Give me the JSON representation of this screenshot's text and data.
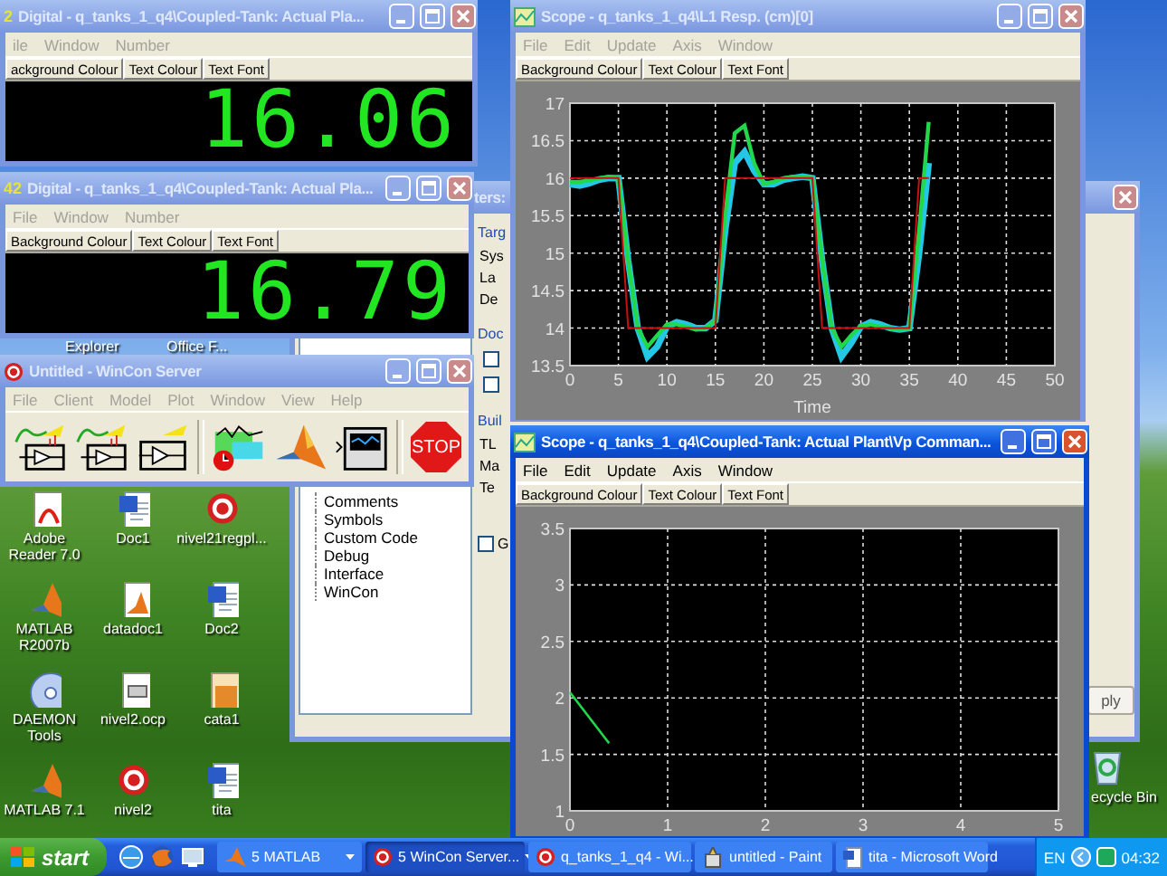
{
  "desktop_icons": [
    {
      "label": "Adobe Reader 7.0",
      "kind": "pdf"
    },
    {
      "label": "Doc1",
      "kind": "word"
    },
    {
      "label": "nivel21regpl...",
      "kind": "wincon"
    },
    {
      "label": "MATLAB R2007b",
      "kind": "matlab"
    },
    {
      "label": "datadoc1",
      "kind": "matfile"
    },
    {
      "label": "Doc2",
      "kind": "word"
    },
    {
      "label": "DAEMON Tools",
      "kind": "disc"
    },
    {
      "label": "nivel2.ocp",
      "kind": "file"
    },
    {
      "label": "cata1",
      "kind": "image"
    },
    {
      "label": "MATLAB 7.1",
      "kind": "matlab"
    },
    {
      "label": "nivel2",
      "kind": "wincon"
    },
    {
      "label": "tita",
      "kind": "word"
    }
  ],
  "partial_icon_labels": [
    "Explorer",
    "Office F..."
  ],
  "recycle_bin": {
    "label": "ecycle Bin"
  },
  "windows": [
    {
      "kind": "digital",
      "active": false,
      "icon_text": "2",
      "title": "Digital - q_tanks_1_q4\\Coupled-Tank: Actual Pla...",
      "menu": [
        "ile",
        "Window",
        "Number"
      ],
      "toolbar": [
        "ackground Colour",
        "Text Colour",
        "Text Font"
      ],
      "reading": "16.06"
    },
    {
      "kind": "scope",
      "active": false,
      "title": "Scope - q_tanks_1_q4\\L1 Resp. (cm)[0]",
      "menu": [
        "File",
        "Edit",
        "Update",
        "Axis",
        "Window"
      ],
      "toolbar": [
        "Background Colour",
        "Text Colour",
        "Text Font"
      ],
      "chart_data": {
        "type": "line",
        "grid": true,
        "xlabel": "Time",
        "x": [
          0,
          1,
          2,
          3,
          4,
          5,
          6,
          7,
          8,
          9,
          10,
          11,
          12,
          13,
          14,
          15,
          16,
          17,
          18,
          19,
          20,
          21,
          22,
          23,
          24,
          25,
          26,
          27,
          28,
          29,
          30,
          31,
          32,
          33,
          34,
          35,
          36,
          37
        ],
        "xlim": [
          0,
          50
        ],
        "ylim": [
          13.5,
          17
        ],
        "xticks": [
          0,
          5,
          10,
          15,
          20,
          25,
          30,
          35,
          40,
          45,
          50
        ],
        "yticks": [
          13.5,
          14,
          14.5,
          15,
          15.5,
          16,
          16.5,
          17
        ],
        "series": [
          {
            "color": "#c81010",
            "values": [
              16,
              16,
              16,
              16,
              16,
              16,
              14,
              14,
              14,
              14,
              14,
              14,
              14,
              14,
              14,
              14,
              16,
              16,
              16,
              16,
              16,
              16,
              16,
              16,
              16,
              16,
              14,
              14,
              14,
              14,
              14,
              14,
              14,
              14,
              14,
              14,
              16,
              16
            ]
          },
          {
            "color": "#22d84a",
            "values": [
              15.95,
              15.95,
              15.97,
              16,
              16.02,
              16,
              14.9,
              14,
              13.75,
              13.9,
              14.05,
              14.05,
              14.02,
              13.98,
              14,
              14.1,
              15.5,
              16.6,
              16.7,
              16.2,
              15.92,
              15.95,
              16,
              16.02,
              16.02,
              16,
              14.9,
              14,
              13.75,
              13.9,
              14.03,
              14.05,
              14.02,
              14,
              13.98,
              14,
              15.3,
              16.75
            ]
          },
          {
            "color": "#22c8e6",
            "values": [
              15.92,
              15.9,
              15.93,
              15.98,
              16,
              16,
              14.9,
              14,
              13.62,
              13.75,
              14.02,
              14.08,
              14.05,
              14,
              14,
              14.1,
              15.3,
              16.2,
              16.35,
              16.1,
              15.92,
              15.92,
              15.98,
              16,
              16.02,
              16,
              14.9,
              14,
              13.62,
              13.8,
              14.02,
              14.08,
              14.05,
              14,
              13.98,
              14,
              15,
              16.2
            ]
          }
        ]
      }
    },
    {
      "kind": "digital",
      "active": false,
      "icon_text": "42",
      "title": "Digital - q_tanks_1_q4\\Coupled-Tank: Actual Pla...",
      "menu": [
        "File",
        "Window",
        "Number"
      ],
      "toolbar": [
        "Background Colour",
        "Text Colour",
        "Text Font"
      ],
      "reading": "16.79"
    },
    {
      "kind": "options",
      "active": false,
      "title": "ters:",
      "sections": [
        {
          "heading": "Targ",
          "items": [
            {
              "kind": "label",
              "text": "Sys"
            },
            {
              "kind": "label",
              "text": "La"
            },
            {
              "kind": "label",
              "text": "De"
            }
          ]
        },
        {
          "heading": "Doc",
          "items": [
            {
              "kind": "checkbox",
              "checked": false
            },
            {
              "kind": "checkbox",
              "checked": false
            }
          ]
        },
        {
          "heading": "Buil",
          "items": [
            {
              "kind": "label",
              "text": "TL"
            },
            {
              "kind": "label",
              "text": "Ma"
            },
            {
              "kind": "label",
              "text": "Te"
            }
          ]
        }
      ],
      "checkbox": {
        "label": "G",
        "checked": false
      },
      "tree": [
        "Comments",
        "Symbols",
        "Custom Code",
        "Debug",
        "Interface",
        "WinCon"
      ],
      "button": "ply"
    },
    {
      "kind": "wincon",
      "active": false,
      "title": "Untitled - WinCon Server",
      "menu": [
        "File",
        "Client",
        "Model",
        "Plot",
        "Window",
        "View",
        "Help"
      ],
      "tools": [
        {
          "kind": "plot_amp"
        },
        {
          "kind": "plot_amp"
        },
        {
          "kind": "amp"
        },
        {
          "kind": "separator"
        },
        {
          "kind": "plot_clock"
        },
        {
          "kind": "peak"
        },
        {
          "kind": "scope"
        },
        {
          "kind": "separator"
        },
        {
          "kind": "stop",
          "label": "STOP"
        }
      ]
    },
    {
      "kind": "scope",
      "active": true,
      "title": "Scope - q_tanks_1_q4\\Coupled-Tank: Actual Plant\\Vp Comman...",
      "menu": [
        "File",
        "Edit",
        "Update",
        "Axis",
        "Window"
      ],
      "toolbar": [
        "Background Colour",
        "Text Colour",
        "Text Font"
      ],
      "chart_data": {
        "type": "line",
        "grid": true,
        "x": [
          0,
          0.4
        ],
        "xlim": [
          0,
          5
        ],
        "ylim": [
          1,
          3.5
        ],
        "xticks": [
          0,
          1,
          2,
          3,
          4,
          5
        ],
        "yticks": [
          1,
          1.5,
          2,
          2.5,
          3,
          3.5
        ],
        "series": [
          {
            "color": "#22d84a",
            "values": [
              2.05,
              1.6
            ]
          }
        ]
      }
    }
  ],
  "taskbar": {
    "start": "start",
    "tasks": [
      {
        "label": "5 MATLAB",
        "kind": "matlab",
        "grouped": true,
        "selected": false
      },
      {
        "label": "5 WinCon Server...",
        "kind": "wincon",
        "grouped": true,
        "selected": true
      },
      {
        "label": "q_tanks_1_q4 - Wi...",
        "kind": "wincon",
        "grouped": false,
        "selected": false
      },
      {
        "label": "untitled - Paint",
        "kind": "paint",
        "grouped": false,
        "selected": false
      },
      {
        "label": "tita - Microsoft Word",
        "kind": "word",
        "grouped": false,
        "selected": false
      }
    ],
    "language": "EN",
    "clock": "04:32"
  }
}
